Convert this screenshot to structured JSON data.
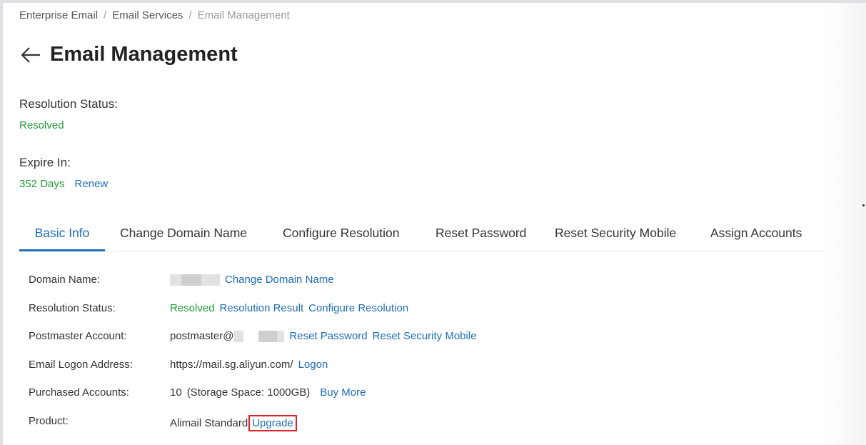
{
  "breadcrumb": {
    "items": [
      "Enterprise Email",
      "Email Services"
    ],
    "current": "Email Management",
    "separator": "/"
  },
  "header": {
    "title": "Email Management",
    "back_icon": "arrow-left-icon"
  },
  "summary": {
    "resolution_status_label": "Resolution Status:",
    "resolution_status_value": "Resolved",
    "expire_label": "Expire In:",
    "expire_value": "352 Days",
    "renew_link": "Renew"
  },
  "tabs": [
    {
      "label": "Basic Info",
      "active": true
    },
    {
      "label": "Change Domain Name",
      "active": false
    },
    {
      "label": "Configure Resolution",
      "active": false
    },
    {
      "label": "Reset Password",
      "active": false
    },
    {
      "label": "Reset Security Mobile",
      "active": false
    },
    {
      "label": "Assign Accounts",
      "active": false
    }
  ],
  "basic_info": {
    "domain_name": {
      "label": "Domain Name:",
      "link": "Change Domain Name"
    },
    "resolution_status": {
      "label": "Resolution Status:",
      "value": "Resolved",
      "links": [
        "Resolution Result",
        "Configure Resolution"
      ]
    },
    "postmaster": {
      "label": "Postmaster Account:",
      "value_prefix": "postmaster@",
      "links": [
        "Reset Password",
        "Reset Security Mobile"
      ]
    },
    "logon_address": {
      "label": "Email Logon Address:",
      "value": "https://mail.sg.aliyun.com/",
      "link": "Logon"
    },
    "purchased_accounts": {
      "label": "Purchased Accounts:",
      "value": "10",
      "storage": "(Storage Space: 1000GB)",
      "link": "Buy More"
    },
    "product": {
      "label": "Product:",
      "value": "Alimail Standard",
      "link": "Upgrade"
    }
  },
  "colors": {
    "accent": "#1f6db8",
    "success": "#1f9b34",
    "highlight": "#d9262e"
  }
}
